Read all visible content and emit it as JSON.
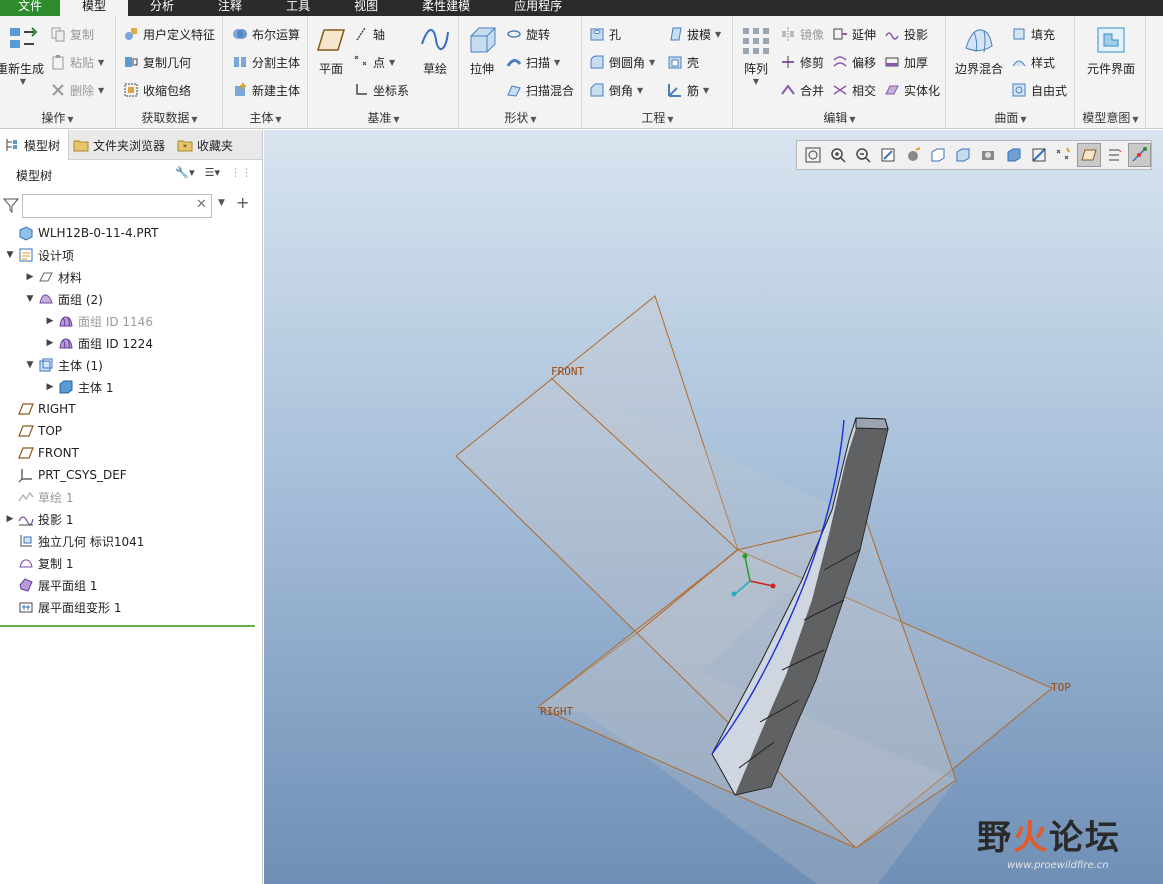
{
  "menu": {
    "tabs": [
      "文件",
      "模型",
      "分析",
      "注释",
      "工具",
      "视图",
      "柔性建模",
      "应用程序"
    ],
    "active": "模型"
  },
  "ribbon": {
    "operations": {
      "label": "操作",
      "regen": "重新生成",
      "copy": "复制",
      "paste": "粘贴",
      "delete": "删除"
    },
    "getdata": {
      "label": "获取数据",
      "udf": "用户定义特征",
      "copygeom": "复制几何",
      "shrinkwrap": "收缩包络"
    },
    "body": {
      "label": "主体",
      "boolean": "布尔运算",
      "split": "分割主体",
      "newbody": "新建主体"
    },
    "datum": {
      "label": "基准",
      "plane": "平面",
      "axis": "轴",
      "point": "点",
      "csys": "坐标系",
      "sketch": "草绘"
    },
    "shapes": {
      "label": "形状",
      "extrude": "拉伸",
      "revolve": "旋转",
      "sweep": "扫描",
      "sweptblend": "扫描混合"
    },
    "engineering": {
      "label": "工程",
      "hole": "孔",
      "round": "倒圆角",
      "chamfer": "倒角",
      "draft": "拔模",
      "shell": "壳",
      "rib": "筋"
    },
    "editing": {
      "label": "编辑",
      "pattern": "阵列",
      "mirror": "镜像",
      "trim": "修剪",
      "merge": "合并",
      "extend": "延伸",
      "offset": "偏移",
      "intersect": "相交",
      "project": "投影",
      "thicken": "加厚",
      "solidify": "实体化"
    },
    "surfaces": {
      "label": "曲面",
      "boundary": "边界混合",
      "fill": "填充",
      "style": "样式",
      "freestyle": "自由式"
    },
    "intent": {
      "label": "模型意图",
      "interface": "元件界面"
    }
  },
  "panel": {
    "tabs": [
      "模型树",
      "文件夹浏览器",
      "收藏夹"
    ],
    "header": "模型树",
    "filter_placeholder": ""
  },
  "tree": [
    {
      "label": "WLH12B-0-11-4.PRT",
      "icon": "part-icon",
      "level": 0,
      "arrow": "",
      "dim": false
    },
    {
      "label": "设计项",
      "icon": "design-items-icon",
      "level": 0,
      "arrow": "▼",
      "dim": false
    },
    {
      "label": "材料",
      "icon": "material-icon",
      "level": 1,
      "arrow": "▶",
      "dim": false
    },
    {
      "label": "面组 (2)",
      "icon": "quilt-group-icon",
      "level": 1,
      "arrow": "▼",
      "dim": false
    },
    {
      "label": "面组 ID 1146",
      "icon": "quilt-icon",
      "level": 2,
      "arrow": "▶",
      "dim": true
    },
    {
      "label": "面组 ID 1224",
      "icon": "quilt-icon",
      "level": 2,
      "arrow": "▶",
      "dim": false
    },
    {
      "label": "主体 (1)",
      "icon": "body-group-icon",
      "level": 1,
      "arrow": "▼",
      "dim": false
    },
    {
      "label": "主体 1",
      "icon": "body-icon",
      "level": 2,
      "arrow": "▶",
      "dim": false
    },
    {
      "label": "RIGHT",
      "icon": "datum-plane-icon",
      "level": 0,
      "arrow": "",
      "dim": false
    },
    {
      "label": "TOP",
      "icon": "datum-plane-icon",
      "level": 0,
      "arrow": "",
      "dim": false
    },
    {
      "label": "FRONT",
      "icon": "datum-plane-icon",
      "level": 0,
      "arrow": "",
      "dim": false
    },
    {
      "label": "PRT_CSYS_DEF",
      "icon": "csys-icon",
      "level": 0,
      "arrow": "",
      "dim": false
    },
    {
      "label": "草绘 1",
      "icon": "sketch-icon",
      "level": 0,
      "arrow": "",
      "dim": true
    },
    {
      "label": "投影 1",
      "icon": "projection-icon",
      "level": 0,
      "arrow": "▶",
      "dim": false
    },
    {
      "label": "独立几何 标识1041",
      "icon": "independent-geometry-icon",
      "level": 0,
      "arrow": "",
      "dim": false
    },
    {
      "label": "复制 1",
      "icon": "copy-feature-icon",
      "level": 0,
      "arrow": "",
      "dim": false
    },
    {
      "label": "展平面组 1",
      "icon": "flatten-quilt-icon",
      "level": 0,
      "arrow": "",
      "dim": false
    },
    {
      "label": "展平面组变形 1",
      "icon": "flatten-deform-icon",
      "level": 0,
      "arrow": "",
      "dim": false
    }
  ],
  "viewport": {
    "datum_labels": {
      "front": "FRONT",
      "right": "RIGHT",
      "top": "TOP"
    },
    "watermark": {
      "brand_a": "野",
      "brand_b": "火",
      "brand_c": "论坛",
      "url": "www.proewildfire.cn"
    }
  },
  "colors": {
    "file_tab": "#2d8a2d",
    "datum_plane": "#b06a2a",
    "curve": "#1a2fd8",
    "body_fill": "#cfd6e0"
  }
}
